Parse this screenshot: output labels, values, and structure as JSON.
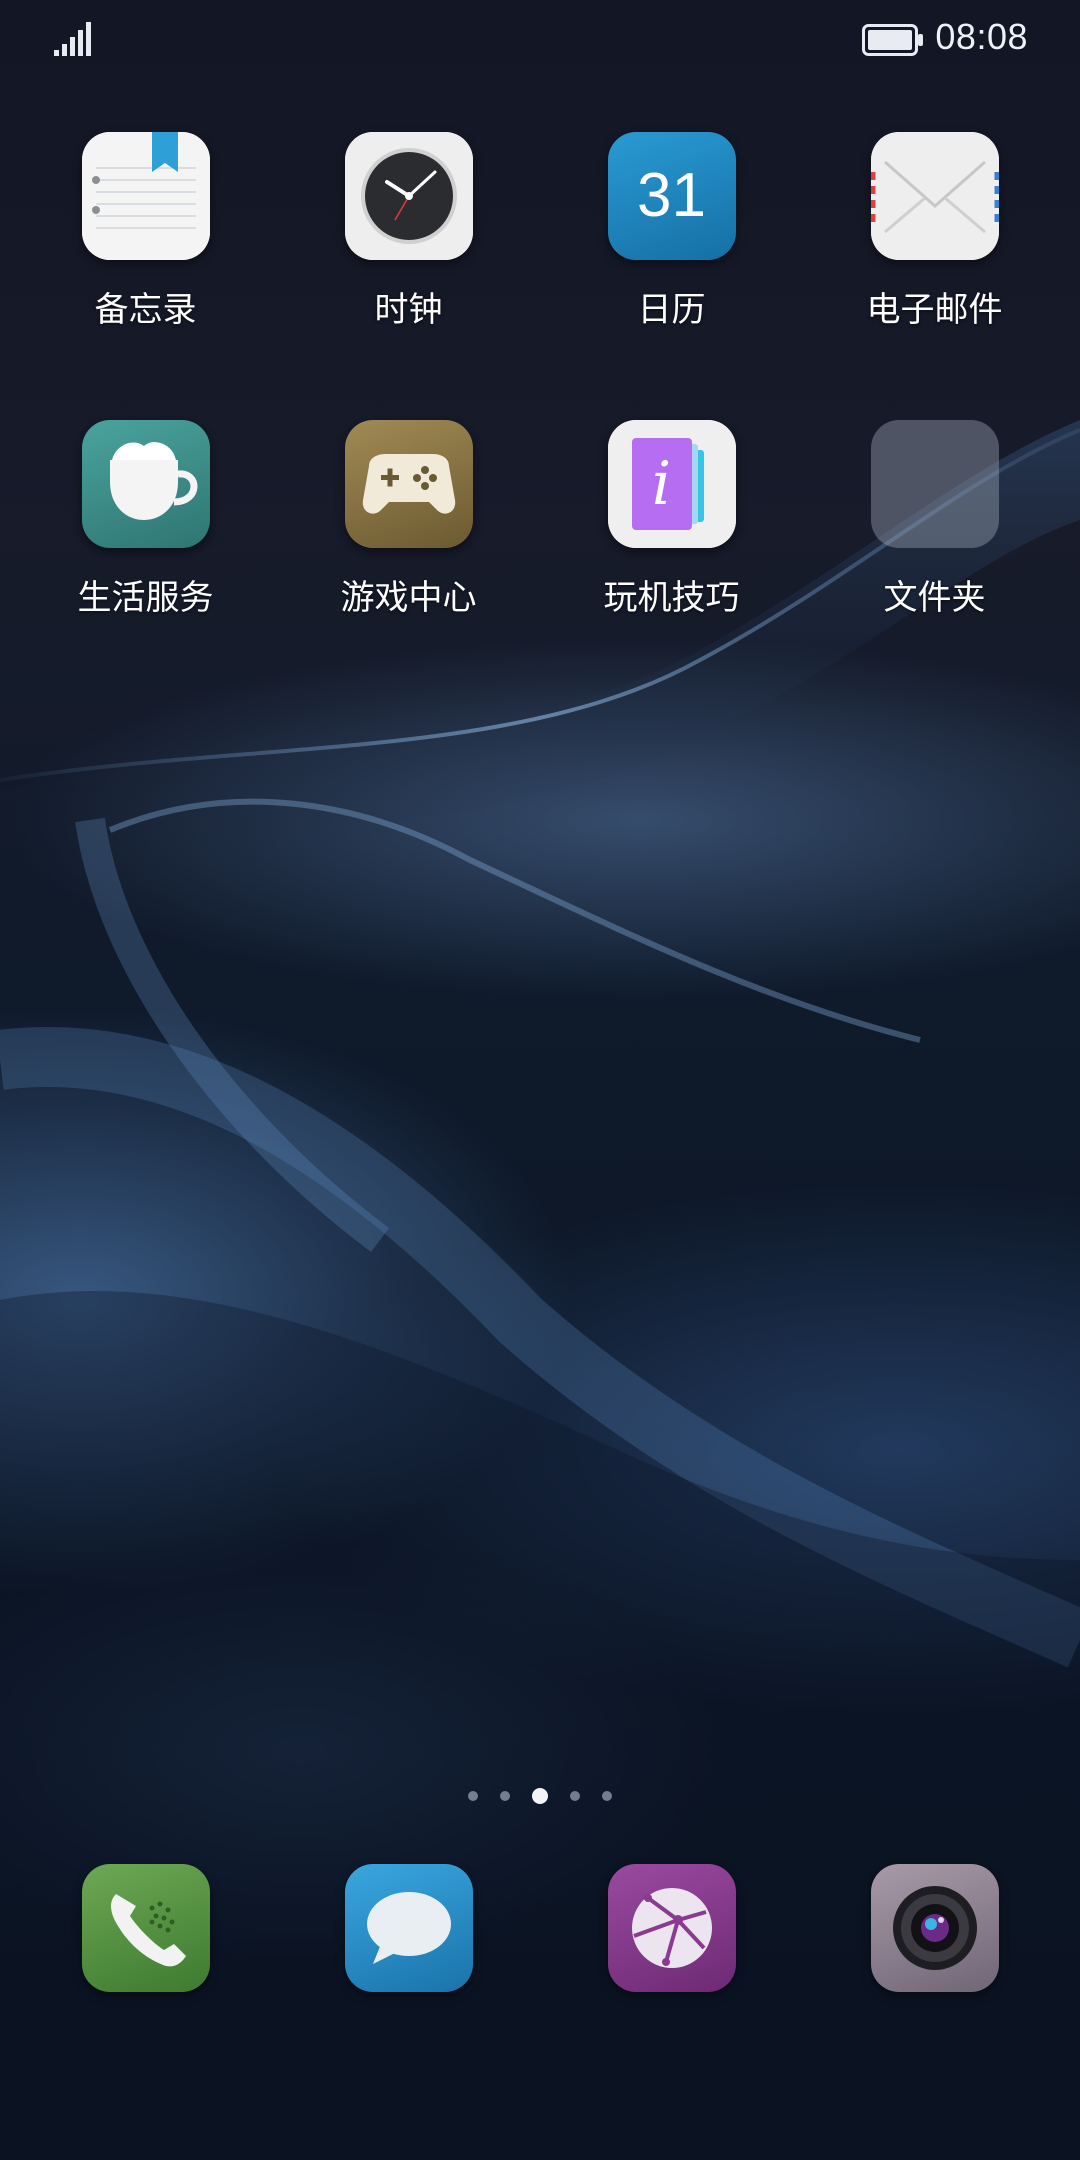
{
  "status_bar": {
    "time": "08:08",
    "signal_icon": "signal-bars-icon",
    "battery_icon": "battery-icon"
  },
  "home": {
    "apps": [
      {
        "label": "备忘录",
        "icon": "notes-icon"
      },
      {
        "label": "时钟",
        "icon": "clock-icon"
      },
      {
        "label": "日历",
        "icon": "calendar-icon",
        "badge_text": "31"
      },
      {
        "label": "电子邮件",
        "icon": "email-icon"
      },
      {
        "label": "生活服务",
        "icon": "coffee-cup-icon"
      },
      {
        "label": "游戏中心",
        "icon": "gamepad-icon"
      },
      {
        "label": "玩机技巧",
        "icon": "tips-icon",
        "glyph": "i"
      },
      {
        "label": "文件夹",
        "icon": "folder-icon"
      }
    ]
  },
  "page_indicator": {
    "count": 5,
    "active_index": 2
  },
  "dock": {
    "apps": [
      {
        "name": "phone",
        "icon": "phone-icon"
      },
      {
        "name": "messages",
        "icon": "message-bubble-icon"
      },
      {
        "name": "browser",
        "icon": "browser-globe-icon"
      },
      {
        "name": "camera",
        "icon": "camera-icon"
      }
    ]
  },
  "colors": {
    "calendar_tile": "#1f86bf",
    "life_service_tile": "#3f8e8a",
    "game_center_tile": "#8a7645",
    "phone_tile": "#5c9646",
    "messages_tile": "#2b93cf",
    "browser_tile": "#8a3a8f",
    "camera_tile": "#8d8290"
  }
}
